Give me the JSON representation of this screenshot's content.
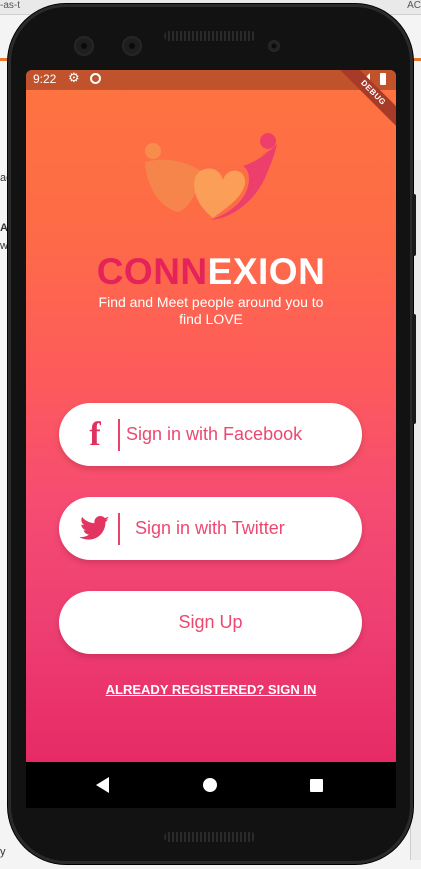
{
  "background_page": {
    "tab_text": "-as-t",
    "tab_text_right": "AC",
    "snippet_a": "ad",
    "snippet_b": "A",
    "snippet_c": "w",
    "snippet_d": "y"
  },
  "status_bar": {
    "time": "9:22",
    "icons": [
      "gear-icon",
      "sync-circle-icon",
      "signal-icon",
      "battery-icon"
    ],
    "debug_banner": "DEBUG"
  },
  "app": {
    "logo_icon": "couple-heart-logo",
    "brand_part1": "CONN",
    "brand_part2": "EXION",
    "tagline": "Find and Meet people around you to find LOVE",
    "facebook_button": "Sign in with Facebook",
    "twitter_button": "Sign in with Twitter",
    "signup_button": "Sign Up",
    "signin_link": "ALREADY REGISTERED? SIGN IN"
  },
  "colors": {
    "gradient_top": "#fe7440",
    "gradient_bottom": "#e72a66",
    "brand_accent": "#e4235a",
    "button_text": "#ec4870",
    "status_bar": "#c0532c"
  },
  "nav_bar": {
    "icons": [
      "back-triangle-icon",
      "home-circle-icon",
      "recents-square-icon"
    ]
  }
}
